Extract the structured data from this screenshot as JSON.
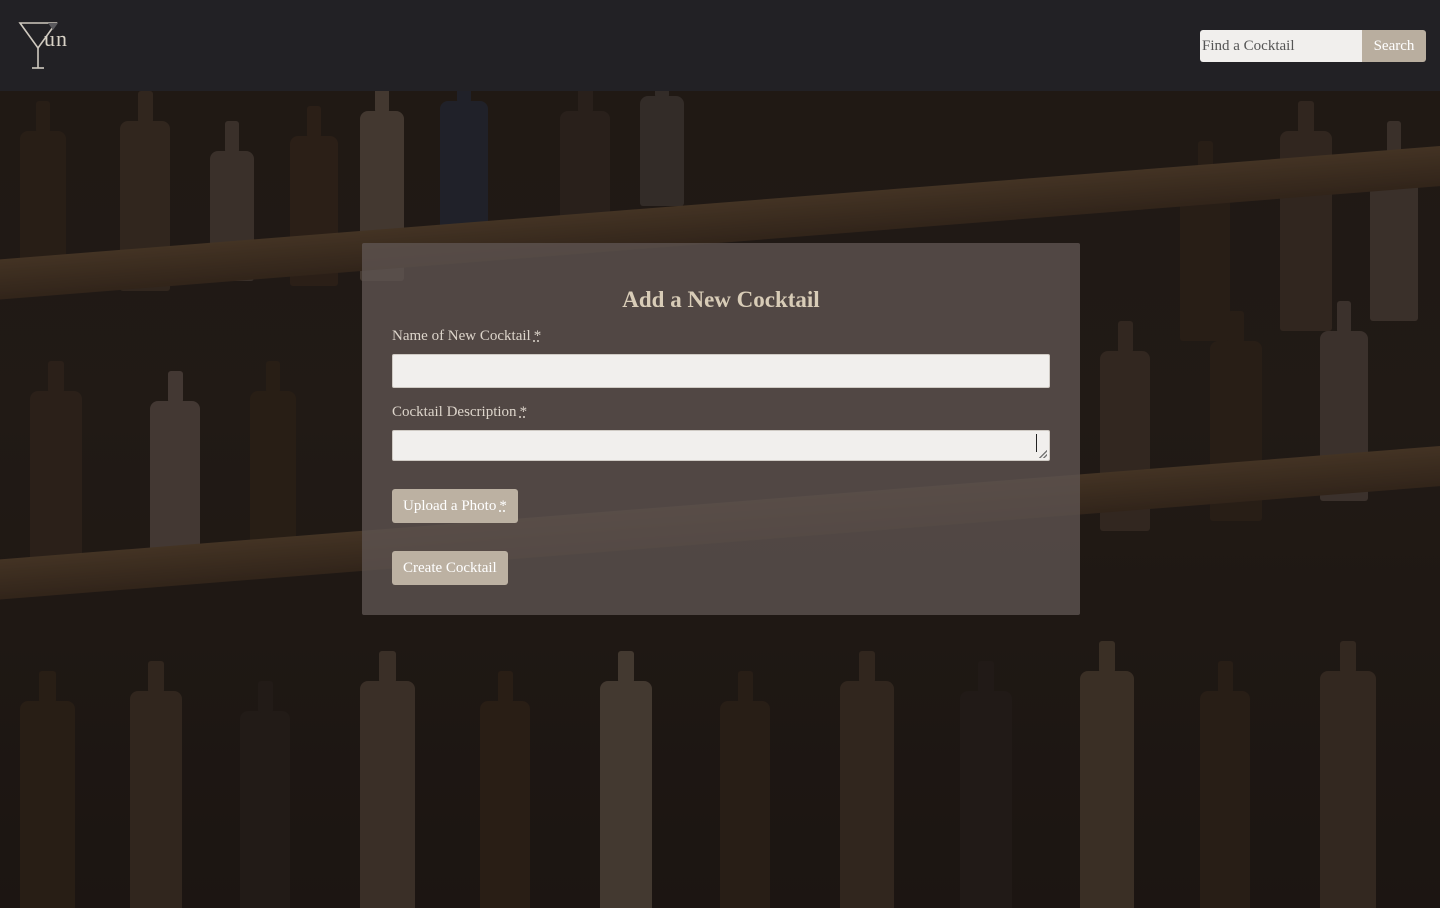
{
  "header": {
    "logo_text": "un",
    "search_placeholder": "Find a Cocktail",
    "search_button_label": "Search"
  },
  "form": {
    "title": "Add a New Cocktail",
    "name_label": "Name of New Cocktail",
    "name_required_mark": "*",
    "name_value": "",
    "description_label": "Cocktail Description",
    "description_required_mark": "*",
    "description_value": "",
    "upload_label": "Upload a Photo",
    "upload_required_mark": "*",
    "submit_label": "Create Cocktail"
  },
  "colors": {
    "navbar": "#222125",
    "accent_button": "#bcb1a2",
    "title": "#d8ccb7"
  }
}
